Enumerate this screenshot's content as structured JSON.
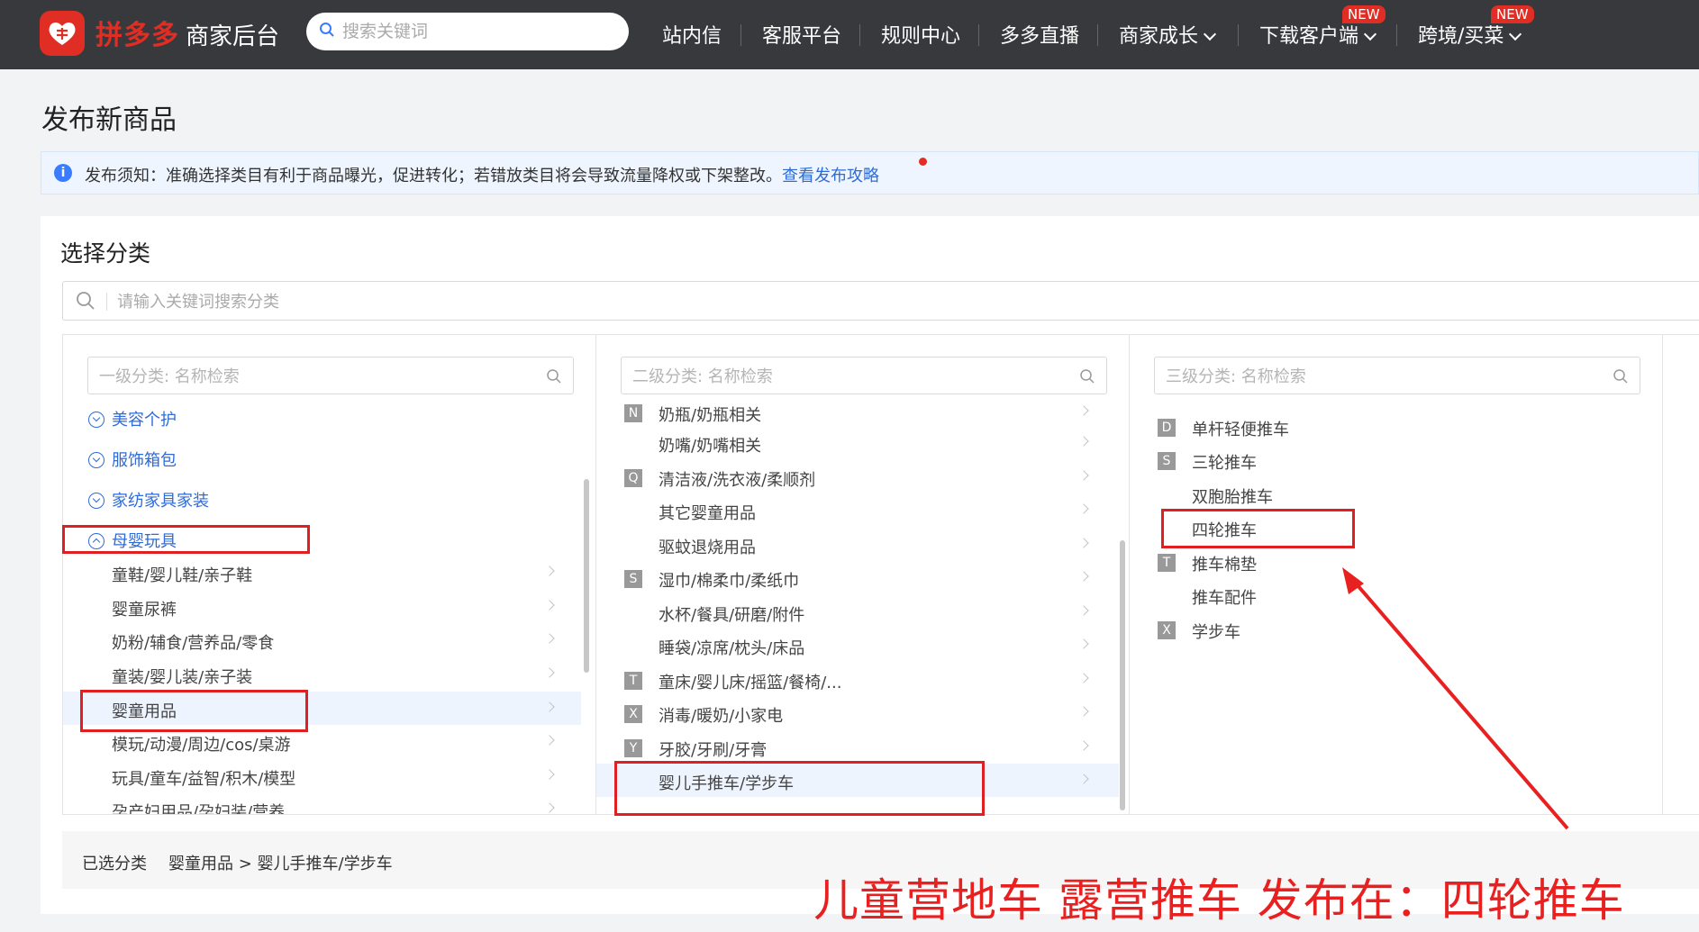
{
  "brand": {
    "logo_icon": "pinduoduo-logo-icon",
    "name": "拼多多",
    "sub": "商家后台"
  },
  "top_search": {
    "placeholder": "搜索关键词"
  },
  "nav": {
    "items": [
      {
        "label": "站内信"
      },
      {
        "label": "客服平台"
      },
      {
        "label": "规则中心"
      },
      {
        "label": "多多直播"
      },
      {
        "label": "商家成长"
      },
      {
        "label": "下载客户端",
        "badge": "NEW"
      },
      {
        "label": "跨境/买菜",
        "badge": "NEW"
      }
    ]
  },
  "page_title": "发布新商品",
  "notice": {
    "text": "发布须知：准确选择类目有利于商品曝光，促进转化；若错放类目将会导致流量降权或下架整改。",
    "link": "查看发布攻略"
  },
  "panel": {
    "title": "选择分类",
    "search_placeholder": "请输入关键词搜索分类"
  },
  "col1": {
    "placeholder": "一级分类: 名称检索",
    "groups": [
      "美容个护",
      "服饰箱包",
      "家纺家具家装",
      "母婴玩具"
    ],
    "items": [
      "童鞋/婴儿鞋/亲子鞋",
      "婴童尿裤",
      "奶粉/辅食/营养品/零食",
      "童装/婴儿装/亲子装",
      "婴童用品",
      "模玩/动漫/周边/cos/桌游",
      "玩具/童车/益智/积木/模型",
      "孕产妇用品/孕妇装/营养"
    ]
  },
  "col2": {
    "placeholder": "二级分类: 名称检索",
    "items": [
      {
        "letter": "N",
        "label": "奶瓶/奶瓶相关"
      },
      {
        "letter": "",
        "label": "奶嘴/奶嘴相关"
      },
      {
        "letter": "Q",
        "label": "清洁液/洗衣液/柔顺剂"
      },
      {
        "letter": "",
        "label": "其它婴童用品"
      },
      {
        "letter": "",
        "label": "驱蚊退烧用品"
      },
      {
        "letter": "S",
        "label": "湿巾/棉柔巾/柔纸巾"
      },
      {
        "letter": "",
        "label": "水杯/餐具/研磨/附件"
      },
      {
        "letter": "",
        "label": "睡袋/凉席/枕头/床品"
      },
      {
        "letter": "T",
        "label": "童床/婴儿床/摇篮/餐椅/..."
      },
      {
        "letter": "X",
        "label": "消毒/暖奶/小家电"
      },
      {
        "letter": "Y",
        "label": "牙胶/牙刷/牙膏"
      },
      {
        "letter": "",
        "label": "婴儿手推车/学步车"
      }
    ]
  },
  "col3": {
    "placeholder": "三级分类: 名称检索",
    "items": [
      {
        "letter": "D",
        "label": "单杆轻便推车"
      },
      {
        "letter": "S",
        "label": "三轮推车"
      },
      {
        "letter": "",
        "label": "双胞胎推车"
      },
      {
        "letter": "",
        "label": "四轮推车"
      },
      {
        "letter": "T",
        "label": "推车棉垫"
      },
      {
        "letter": "",
        "label": "推车配件"
      },
      {
        "letter": "X",
        "label": "学步车"
      }
    ]
  },
  "selected": {
    "key": "已选分类",
    "value": "婴童用品 > 婴儿手推车/学步车"
  },
  "annotation": {
    "text": "儿童营地车 露营推车 发布在：四轮推车",
    "color": "#e82020"
  },
  "colors": {
    "accent_red": "#e02e24",
    "link_blue": "#2f6bd8",
    "topbar": "#38393d"
  }
}
